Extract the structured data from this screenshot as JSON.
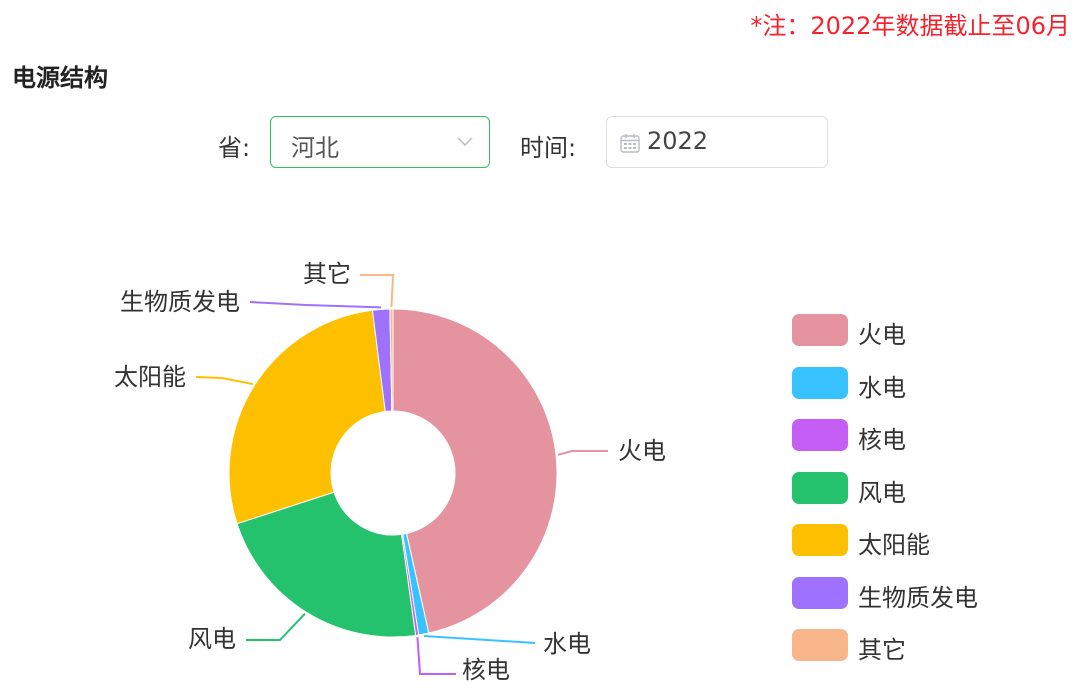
{
  "note": "*注：2022年数据截止至06月",
  "section_title": "电源结构",
  "filters": {
    "province_label": "省:",
    "province_value": "河北",
    "time_label": "时间:",
    "time_value": "2022"
  },
  "colors": {
    "accent": "#2fbf5c",
    "note": "#f5222d"
  },
  "chart_data": {
    "type": "pie",
    "style": "donut",
    "legend_position": "right",
    "series": [
      {
        "name": "火电",
        "value": 46.5,
        "color": "#e5949f"
      },
      {
        "name": "水电",
        "value": 1.0,
        "color": "#38c2ff"
      },
      {
        "name": "核电",
        "value": 0.3,
        "color": "#c45ef5"
      },
      {
        "name": "风电",
        "value": 22.2,
        "color": "#25c26e"
      },
      {
        "name": "太阳能",
        "value": 28.0,
        "color": "#fdc000"
      },
      {
        "name": "生物质发电",
        "value": 1.7,
        "color": "#9e72ff"
      },
      {
        "name": "其它",
        "value": 0.3,
        "color": "#f8b68a"
      }
    ]
  }
}
